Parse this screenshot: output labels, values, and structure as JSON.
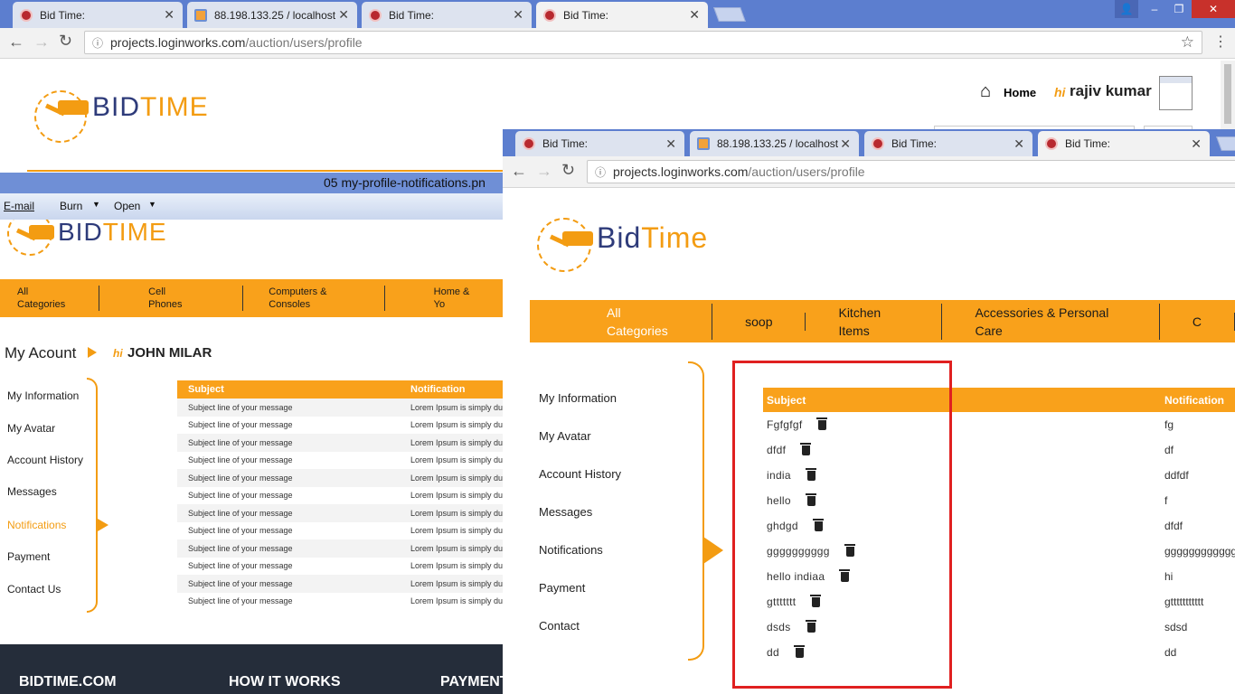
{
  "top_window": {
    "tabs": [
      {
        "label": "Bid Time:",
        "icon": "bidtime-favicon"
      },
      {
        "label": "88.198.133.25 / localhost",
        "icon": "phpmyadmin-favicon"
      },
      {
        "label": "Bid Time:",
        "icon": "bidtime-favicon"
      },
      {
        "label": "Bid Time:",
        "icon": "bidtime-favicon"
      }
    ],
    "url_main": "projects.loginworks.com",
    "url_path": "/auction/users/profile",
    "home_label": "Home",
    "greeting_hi": "hi",
    "greeting_name": "rajiv kumar"
  },
  "viewer": {
    "title": "05 my-profile-notifications.pn",
    "menu": [
      "E-mail",
      "Burn",
      "Open"
    ]
  },
  "mockup": {
    "logo_bid": "BID",
    "logo_time": "TIME",
    "categories": [
      "All Categories",
      "Cell Phones",
      "Computers & Consoles",
      "Home & Yo"
    ],
    "account_title": "My Acount",
    "hi": "hi",
    "user_name": "JOHN MILAR",
    "sidebar": [
      "My Information",
      "My Avatar",
      "Account History",
      "Messages",
      "Notifications",
      "Payment",
      "Contact Us"
    ],
    "table_headers": {
      "subject": "Subject",
      "notification": "Notification"
    },
    "row_subject": "Subject line of your message",
    "row_notification": "Lorem Ipsum is simply dur",
    "row_count": 12,
    "footer": [
      "BIDTIME.COM",
      "HOW IT WORKS",
      "PAYMENT"
    ]
  },
  "live": {
    "tabs": [
      {
        "label": "Bid Time:",
        "icon": "bidtime-favicon"
      },
      {
        "label": "88.198.133.25 / localhost",
        "icon": "phpmyadmin-favicon"
      },
      {
        "label": "Bid Time:",
        "icon": "bidtime-favicon"
      },
      {
        "label": "Bid Time:",
        "icon": "bidtime-favicon"
      }
    ],
    "url_main": "projects.loginworks.com",
    "url_path": "/auction/users/profile",
    "logo_bid": "Bid",
    "logo_time": "Time",
    "categories": [
      "All Categories",
      "soop",
      "Kitchen Items",
      "Accessories & Personal Care",
      "C"
    ],
    "sidebar": [
      "My Information",
      "My Avatar",
      "Account History",
      "Messages",
      "Notifications",
      "Payment",
      "Contact"
    ],
    "table_headers": {
      "subject": "Subject",
      "notification": "Notification"
    },
    "rows": [
      {
        "subject": "Fgfgfgf",
        "notification": "fg"
      },
      {
        "subject": "dfdf",
        "notification": "df"
      },
      {
        "subject": "india",
        "notification": "ddfdf"
      },
      {
        "subject": "hello",
        "notification": "f"
      },
      {
        "subject": "ghdgd",
        "notification": "dfdf"
      },
      {
        "subject": "gggggggggg",
        "notification": "gggggggggggg"
      },
      {
        "subject": "hello indiaa",
        "notification": "hi"
      },
      {
        "subject": "gttttttt",
        "notification": "gttttttttttt"
      },
      {
        "subject": "dsds",
        "notification": "sdsd"
      },
      {
        "subject": "dd",
        "notification": "dd"
      }
    ]
  },
  "colors": {
    "accent": "#f9a11b",
    "brand_blue": "#2e3b7a",
    "highlight": "#e02020",
    "tabbar": "#5c7ecf"
  }
}
